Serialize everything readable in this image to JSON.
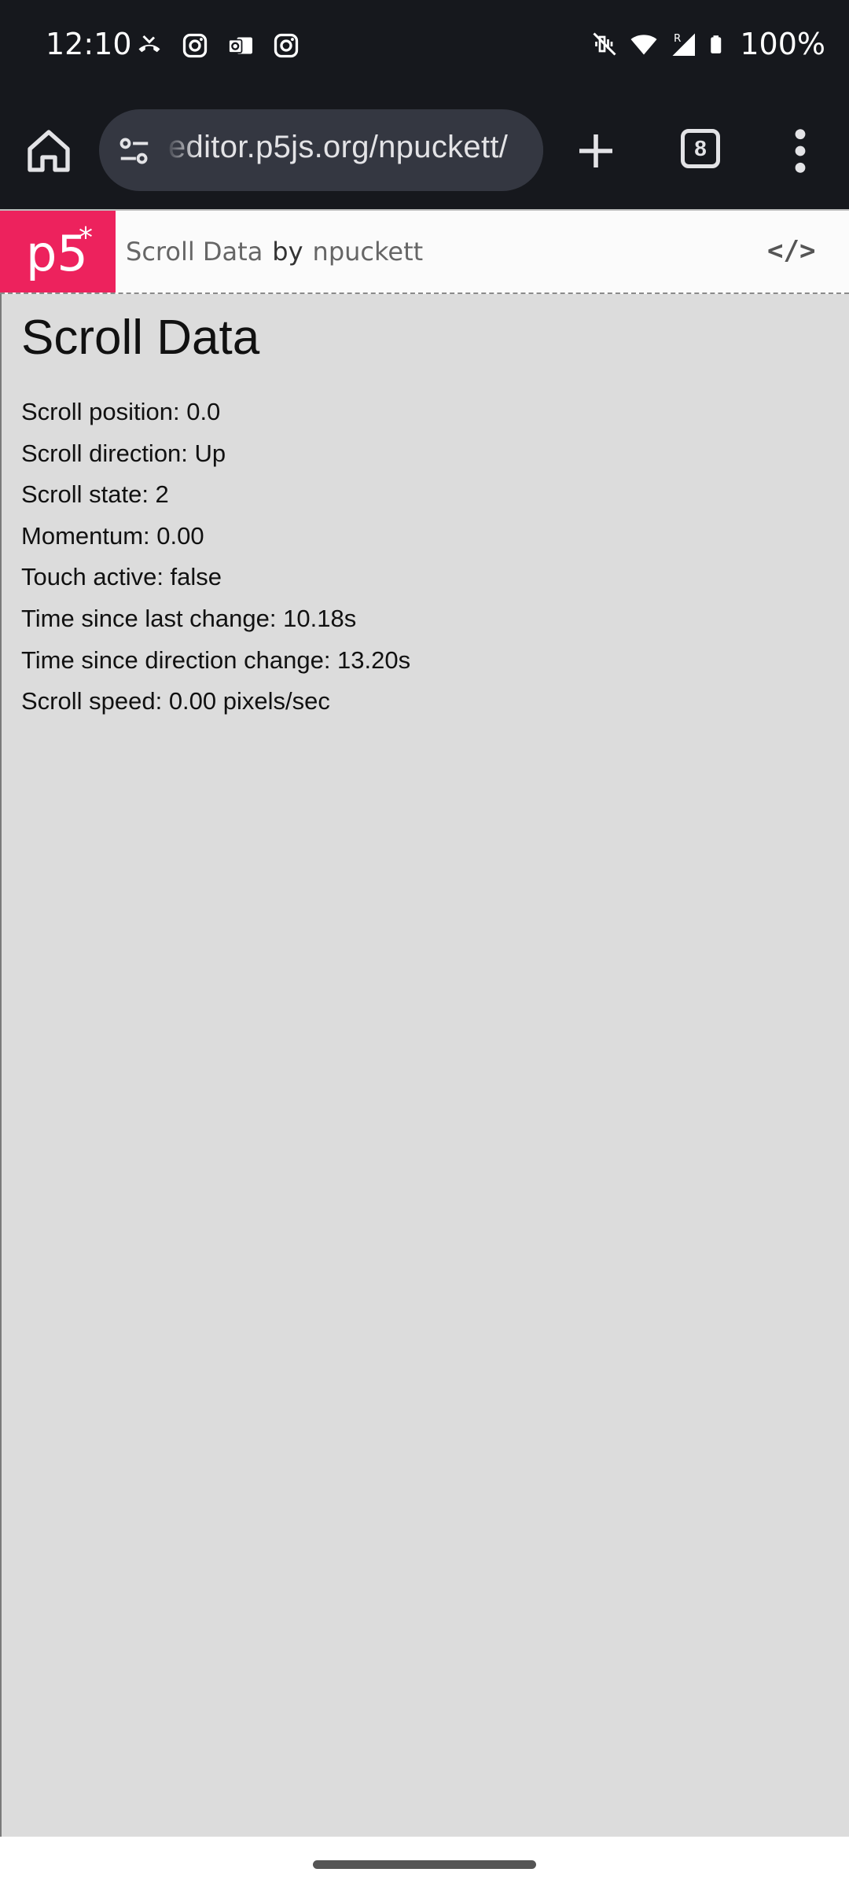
{
  "status_bar": {
    "time": "12:10",
    "left_icons": [
      "missed-call-icon",
      "instagram-icon",
      "outlook-icon",
      "instagram-icon"
    ],
    "right_icons": [
      "vibrate-off-icon",
      "wifi-icon",
      "signal-roaming-icon",
      "battery-icon"
    ],
    "roaming_label": "R",
    "battery_percent": "100%"
  },
  "browser": {
    "url": "editor.p5js.org/npuckett/",
    "tab_count": "8",
    "icons": [
      "home-icon",
      "site-settings-icon",
      "plus-icon",
      "menu-dots-icon"
    ]
  },
  "p5_header": {
    "logo_text": "p5",
    "logo_star": "*",
    "sketch_name": "Scroll Data",
    "by_label": "by",
    "author": "npuckett",
    "code_toggle": "</>"
  },
  "sketch": {
    "title": "Scroll Data",
    "lines": [
      "Scroll position: 0.0",
      "Scroll direction: Up",
      "Scroll state: 2",
      "Momentum: 0.00",
      "Touch active: false",
      "Time since last change: 10.18s",
      "Time since direction change: 13.20s",
      "Scroll speed: 0.00 pixels/sec"
    ]
  },
  "colors": {
    "status_bg": "#16181d",
    "url_pill": "#343741",
    "p5_pink": "#ed225d",
    "canvas_bg": "#dcdcdc"
  }
}
